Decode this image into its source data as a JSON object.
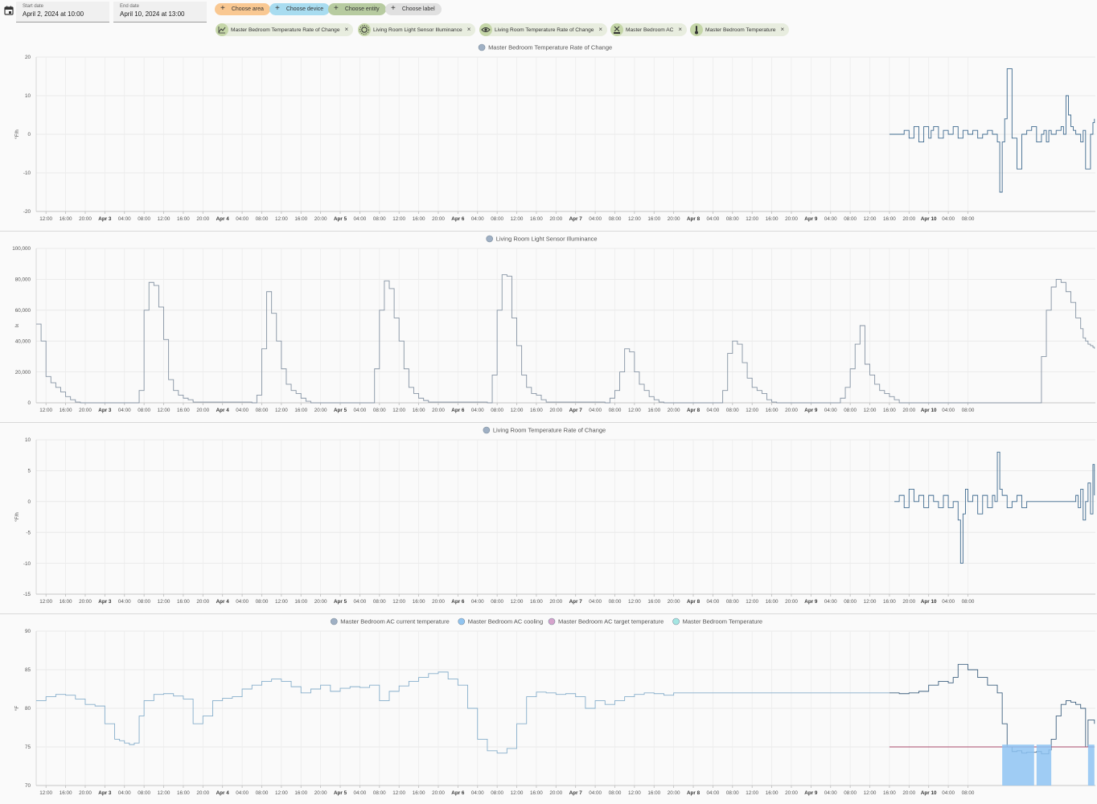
{
  "toolbar": {
    "start_label": "Start date",
    "start_value": "April 2, 2024 at 10:00",
    "end_label": "End date",
    "end_value": "April 10, 2024 at 13:00",
    "pills": [
      {
        "label": "Choose area",
        "color": "#f9c892"
      },
      {
        "label": "Choose device",
        "color": "#a8dcf0"
      },
      {
        "label": "Choose entity",
        "color": "#b7cba0"
      },
      {
        "label": "Choose label",
        "color": "#e0e0e0"
      }
    ],
    "chips": [
      {
        "label": "Master Bedroom Temperature Rate of Change",
        "icon": "chart-line-icon"
      },
      {
        "label": "Living Room Light Sensor Illuminance",
        "icon": "brightness-icon"
      },
      {
        "label": "Living Room Temperature Rate of Change",
        "icon": "eye-icon"
      },
      {
        "label": "Master Bedroom AC",
        "icon": "ac-unit-icon"
      },
      {
        "label": "Master Bedroom Temperature",
        "icon": "thermometer-icon"
      }
    ]
  },
  "x_ticks": [
    "12:00",
    "16:00",
    "20:00",
    "Apr 3",
    "04:00",
    "08:00",
    "12:00",
    "16:00",
    "20:00",
    "Apr 4",
    "04:00",
    "08:00",
    "12:00",
    "16:00",
    "20:00",
    "Apr 5",
    "04:00",
    "08:00",
    "12:00",
    "16:00",
    "20:00",
    "Apr 6",
    "04:00",
    "08:00",
    "12:00",
    "16:00",
    "20:00",
    "Apr 7",
    "04:00",
    "08:00",
    "12:00",
    "16:00",
    "20:00",
    "Apr 8",
    "04:00",
    "08:00",
    "12:00",
    "16:00",
    "20:00",
    "Apr 9",
    "04:00",
    "08:00",
    "12:00",
    "16:00",
    "20:00",
    "Apr 10",
    "04:00",
    "08:00"
  ],
  "chart_data": [
    {
      "type": "line",
      "legend": [
        {
          "name": "Master Bedroom Temperature Rate of Change",
          "color": "#9fb0c4"
        }
      ],
      "ylabel": "°F/h",
      "ylim": [
        -20,
        20
      ],
      "yticks": [
        "20",
        "10",
        "0",
        "-10",
        "-20"
      ],
      "line_color": "#3f6a8f",
      "series": [
        {
          "name": "Master Bedroom Temperature Rate of Change",
          "x_hours": [
            174,
            174.5,
            175,
            176,
            177,
            178,
            179,
            180,
            181,
            182,
            182.5,
            183,
            184,
            185,
            186,
            187,
            188,
            189,
            190,
            191,
            192,
            193,
            194,
            195,
            196,
            196.5,
            197,
            197.5,
            198,
            199,
            200,
            201,
            202,
            203,
            204,
            205,
            205.5,
            206,
            206.5,
            207,
            208,
            209,
            209.5,
            210,
            210.5,
            211,
            211.5,
            212,
            213,
            213.5,
            214,
            215,
            215.5,
            215.8
          ],
          "values": [
            0,
            0,
            0,
            0,
            1,
            -1,
            2,
            -2,
            2,
            -1,
            1,
            2,
            -1,
            1,
            0,
            2,
            -1,
            1,
            0,
            1,
            -1,
            0,
            1,
            0,
            -2,
            -15,
            -2,
            4,
            17,
            -1,
            -9,
            0,
            1,
            2,
            -2,
            0,
            1,
            -2,
            1,
            0,
            1,
            2,
            0,
            10,
            5,
            2,
            1,
            0,
            -2,
            1,
            -9,
            0,
            3,
            4
          ]
        }
      ]
    },
    {
      "type": "line",
      "legend": [
        {
          "name": "Living Room Light Sensor Illuminance",
          "color": "#9fb0c4"
        }
      ],
      "ylabel": "lx",
      "ylim": [
        0,
        100000
      ],
      "yticks": [
        "100,000",
        "80,000",
        "60,000",
        "40,000",
        "20,000",
        "0"
      ],
      "line_color": "#8593a3",
      "series": [
        {
          "name": "Living Room Light Sensor Illuminance",
          "x_hours": [
            0,
            1,
            2,
            3,
            4,
            5,
            6,
            7,
            8,
            9,
            10,
            20,
            21,
            22,
            23,
            24,
            25,
            26,
            27,
            28,
            29,
            30,
            31,
            32,
            44,
            45,
            46,
            47,
            48,
            49,
            50,
            51,
            52,
            53,
            54,
            55,
            56,
            68,
            69,
            70,
            71,
            72,
            73,
            74,
            75,
            76,
            77,
            78,
            79,
            80,
            92,
            93,
            94,
            95,
            96,
            97,
            98,
            99,
            100,
            101,
            102,
            103,
            104,
            116,
            117,
            118,
            119,
            120,
            121,
            122,
            123,
            124,
            125,
            126,
            127,
            128,
            140,
            141,
            142,
            143,
            144,
            145,
            146,
            147,
            148,
            149,
            150,
            151,
            152,
            164,
            165,
            166,
            167,
            168,
            169,
            170,
            171,
            172,
            173,
            174,
            175,
            176,
            177,
            178,
            179,
            180,
            181,
            182,
            183,
            184,
            185,
            186,
            187,
            188,
            189,
            190,
            204,
            205,
            206,
            207,
            208,
            209,
            210,
            211,
            212,
            213,
            213.5,
            214,
            214.5,
            215,
            215.5,
            215.8
          ],
          "values": [
            51000,
            40000,
            17000,
            13000,
            10000,
            7000,
            4000,
            2000,
            500,
            0,
            0,
            0,
            8000,
            60000,
            78000,
            76000,
            62000,
            41000,
            15000,
            8000,
            5000,
            3000,
            2000,
            500,
            0,
            5000,
            35000,
            72000,
            58000,
            40000,
            22000,
            12000,
            8000,
            6000,
            3000,
            1000,
            0,
            0,
            22000,
            60000,
            79000,
            74000,
            55000,
            40000,
            22000,
            10000,
            6000,
            3000,
            1500,
            500,
            0,
            18000,
            60000,
            83000,
            82000,
            55000,
            37000,
            18000,
            10000,
            6000,
            5000,
            2000,
            500,
            0,
            3000,
            8000,
            20000,
            35000,
            33000,
            20000,
            12000,
            8000,
            4000,
            2000,
            500,
            0,
            8000,
            32000,
            40000,
            38000,
            26000,
            16000,
            10000,
            8000,
            6000,
            2000,
            500,
            0,
            0,
            3000,
            10000,
            22000,
            38000,
            50000,
            25000,
            18000,
            12000,
            8000,
            6000,
            4000,
            2000,
            0,
            0,
            0,
            0,
            0,
            0,
            0,
            0,
            0,
            0,
            0,
            0,
            0,
            0,
            0,
            0,
            30000,
            60000,
            75000,
            80000,
            78000,
            72000,
            65000,
            55000,
            48000,
            42000,
            40000,
            38000,
            37000,
            36000,
            35000,
            34000
          ]
        }
      ]
    },
    {
      "type": "line",
      "legend": [
        {
          "name": "Living Room Temperature Rate of Change",
          "color": "#9fb0c4"
        }
      ],
      "ylabel": "°F/h",
      "ylim": [
        -15,
        10
      ],
      "yticks": [
        "10",
        "5",
        "0",
        "-5",
        "-10",
        "-15"
      ],
      "line_color": "#3f6a8f",
      "series": [
        {
          "name": "Living Room Temperature Rate of Change",
          "x_hours": [
            175,
            176,
            177,
            178,
            179,
            180,
            181,
            182,
            183,
            184,
            185,
            186,
            187,
            188,
            188.5,
            189,
            189.5,
            190,
            191,
            192,
            193,
            194,
            195,
            195.5,
            196,
            196.5,
            197,
            198,
            199,
            200,
            201,
            202,
            203,
            204,
            205,
            206,
            207,
            208,
            209,
            210,
            211,
            212,
            212.5,
            213,
            213.5,
            214,
            214.5,
            215,
            215.5,
            215.8
          ],
          "values": [
            0,
            1,
            -1,
            2,
            0,
            1,
            -1,
            1,
            0,
            -1,
            1,
            -1,
            0,
            -3,
            -10,
            -2,
            2,
            0,
            1,
            -2,
            1,
            -1,
            1,
            0,
            8,
            2,
            1,
            -1,
            0,
            1,
            -1,
            0,
            0,
            0,
            0,
            0,
            0,
            0,
            0,
            0,
            0,
            1,
            -1,
            2,
            -3,
            0,
            3,
            -2,
            6,
            1
          ]
        }
      ]
    },
    {
      "type": "line",
      "legend": [
        {
          "name": "Master Bedroom AC current temperature",
          "color": "#9fb0c4"
        },
        {
          "name": "Master Bedroom AC cooling",
          "color": "#90c4f0"
        },
        {
          "name": "Master Bedroom AC target temperature",
          "color": "#d6a3cc"
        },
        {
          "name": "Master Bedroom Temperature",
          "color": "#a4e6e2"
        }
      ],
      "ylabel": "°F",
      "ylim": [
        70,
        90
      ],
      "yticks": [
        "90",
        "85",
        "80",
        "75",
        "70"
      ],
      "line_color": "#86aecb",
      "series": [
        {
          "name": "Master Bedroom AC current temperature",
          "x_hours": [
            0,
            2,
            4,
            6,
            8,
            10,
            12,
            14,
            16,
            17,
            18,
            19,
            20,
            21,
            22,
            24,
            26,
            28,
            30,
            32,
            34,
            36,
            38,
            40,
            42,
            44,
            46,
            48,
            50,
            52,
            54,
            56,
            58,
            60,
            62,
            64,
            66,
            68,
            70,
            72,
            74,
            76,
            78,
            80,
            82,
            84,
            86,
            88,
            90,
            92,
            94,
            96,
            98,
            100,
            102,
            104,
            106,
            108,
            110,
            112,
            114,
            116,
            118,
            120,
            122,
            124,
            126,
            128,
            130,
            132,
            134,
            136,
            138,
            140,
            142,
            144,
            146,
            148,
            150,
            152,
            154,
            156,
            158,
            160,
            162,
            164,
            166,
            168,
            170,
            172,
            174
          ],
          "values": [
            81,
            81.5,
            81.8,
            81.7,
            81.2,
            80.5,
            80.3,
            78,
            76,
            75.8,
            75.5,
            75.3,
            75.5,
            79,
            81,
            81.8,
            81.9,
            81.6,
            81.2,
            78,
            79,
            81,
            81.3,
            81.5,
            82.5,
            83,
            83.5,
            83.8,
            83.5,
            82.8,
            82,
            82.5,
            83,
            82.2,
            82.6,
            82.8,
            82.7,
            83,
            81,
            82.2,
            82.9,
            83.5,
            84,
            84.5,
            84.7,
            83.8,
            83,
            80,
            76,
            74.5,
            74.2,
            74.8,
            78,
            81.5,
            82.1,
            82,
            81.8,
            81.9,
            81.5,
            80,
            81,
            80.5,
            81,
            81.5,
            81.8,
            82,
            81.9,
            81.7,
            82,
            82,
            82,
            82,
            82,
            82,
            82,
            82,
            82,
            82,
            82,
            82,
            82,
            82,
            82,
            82,
            82,
            82,
            82,
            82,
            82,
            82,
            82
          ]
        },
        {
          "name": "Master Bedroom Temperature",
          "x_hours": [
            174,
            176,
            178,
            180,
            182,
            184,
            186,
            187,
            188,
            190,
            192,
            194,
            196,
            197,
            198,
            199,
            200,
            201,
            202,
            203,
            204,
            205,
            206,
            206.5,
            207,
            208,
            209,
            210,
            211,
            212,
            213,
            214,
            214.5,
            215,
            215.8
          ],
          "values": [
            82,
            81.9,
            82,
            82.2,
            83,
            83.5,
            83.3,
            84,
            85.7,
            85,
            84,
            83,
            82,
            78,
            75,
            74.4,
            74.5,
            74.2,
            74.3,
            74.3,
            74.4,
            74.1,
            74.1,
            74.6,
            76,
            79,
            80.5,
            81,
            80.8,
            80.5,
            80,
            75,
            78.5,
            78.5,
            78
          ]
        },
        {
          "name": "Master Bedroom AC target temperature",
          "x_hours": [
            174,
            183,
            197,
            215.8
          ],
          "values": [
            75,
            75,
            75,
            75
          ]
        },
        {
          "name": "Master Bedroom AC cooling",
          "spans": [
            [
              197,
              203.5
            ],
            [
              204,
              207
            ],
            [
              214.5,
              215.8
            ]
          ]
        }
      ]
    }
  ]
}
